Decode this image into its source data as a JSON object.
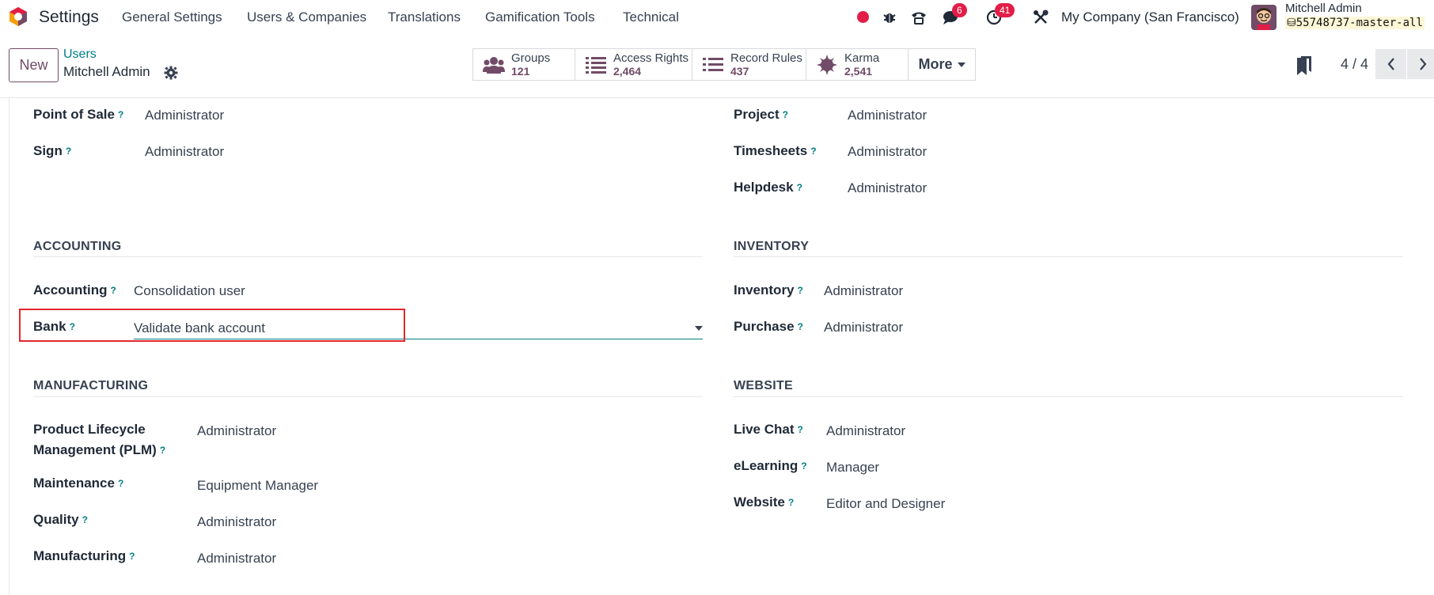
{
  "navbar": {
    "app_name": "Settings",
    "menu": [
      "General Settings",
      "Users & Companies",
      "Translations",
      "Gamification Tools",
      "Technical"
    ],
    "messages_count": "6",
    "activities_count": "41",
    "company": "My Company (San Francisco)",
    "user_name": "Mitchell Admin",
    "database": "55748737-master-all"
  },
  "control": {
    "new_label": "New",
    "breadcrumb_parent": "Users",
    "breadcrumb_current": "Mitchell Admin",
    "stats": [
      {
        "label": "Groups",
        "value": "121",
        "icon": "users-icon"
      },
      {
        "label": "Access Rights",
        "value": "2,464",
        "icon": "list-icon"
      },
      {
        "label": "Record Rules",
        "value": "437",
        "icon": "list-icon"
      },
      {
        "label": "Karma",
        "value": "2,541",
        "icon": "karma-icon"
      }
    ],
    "more_label": "More",
    "pager": "4 / 4"
  },
  "form": {
    "help_mark": "?",
    "top_left": [
      {
        "label": "Point of Sale",
        "value": "Administrator"
      },
      {
        "label": "Sign",
        "value": "Administrator"
      }
    ],
    "top_right": [
      {
        "label": "Project",
        "value": "Administrator"
      },
      {
        "label": "Timesheets",
        "value": "Administrator"
      },
      {
        "label": "Helpdesk",
        "value": "Administrator"
      }
    ],
    "accounting": {
      "title": "ACCOUNTING",
      "fields": [
        {
          "label": "Accounting",
          "value": "Consolidation user"
        },
        {
          "label": "Bank",
          "value": "Validate bank account"
        }
      ]
    },
    "inventory": {
      "title": "INVENTORY",
      "fields": [
        {
          "label": "Inventory",
          "value": "Administrator"
        },
        {
          "label": "Purchase",
          "value": "Administrator"
        }
      ]
    },
    "manufacturing": {
      "title": "MANUFACTURING",
      "fields": [
        {
          "label_line1": "Product Lifecycle",
          "label_line2": "Management (PLM)",
          "value": "Administrator"
        },
        {
          "label": "Maintenance",
          "value": "Equipment Manager"
        },
        {
          "label": "Quality",
          "value": "Administrator"
        },
        {
          "label": "Manufacturing",
          "value": "Administrator"
        }
      ]
    },
    "website": {
      "title": "WEBSITE",
      "fields": [
        {
          "label": "Live Chat",
          "value": "Administrator"
        },
        {
          "label": "eLearning",
          "value": "Manager"
        },
        {
          "label": "Website",
          "value": "Editor and Designer"
        }
      ]
    }
  },
  "colors": {
    "brand": "#714b67",
    "accent": "#017e84",
    "badge": "#e11d48",
    "highlight": "#e3262d"
  }
}
